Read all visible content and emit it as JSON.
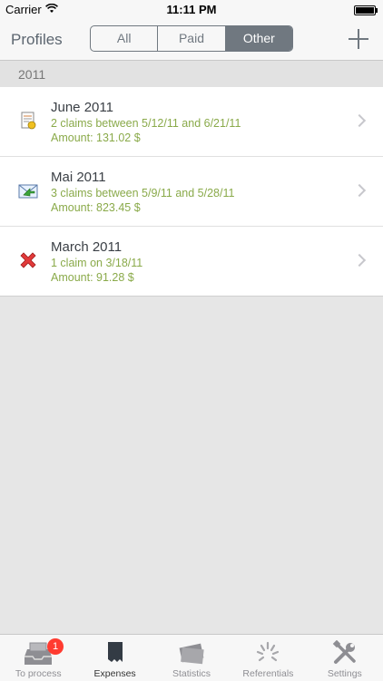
{
  "status_bar": {
    "carrier": "Carrier",
    "time": "11:11 PM"
  },
  "nav": {
    "title": "Profiles",
    "segments": [
      "All",
      "Paid",
      "Other"
    ],
    "selected_segment": "Other"
  },
  "section": {
    "header": "2011"
  },
  "rows": [
    {
      "title": "June 2011",
      "subtitle": "2 claims between 5/12/11 and 6/21/11",
      "amount": "Amount: 131.02 $",
      "icon": "document-icon"
    },
    {
      "title": "Mai 2011",
      "subtitle": "3 claims between 5/9/11 and 5/28/11",
      "amount": "Amount: 823.45 $",
      "icon": "sent-mail-icon"
    },
    {
      "title": "March 2011",
      "subtitle": "1 claim on 3/18/11",
      "amount": "Amount: 91.28 $",
      "icon": "red-x-icon"
    }
  ],
  "tabs": [
    {
      "label": "To process",
      "icon": "inbox-tray-icon",
      "badge": "1"
    },
    {
      "label": "Expenses",
      "icon": "receipt-icon",
      "active": true
    },
    {
      "label": "Statistics",
      "icon": "tickets-icon"
    },
    {
      "label": "Referentials",
      "icon": "loading-spinner-icon"
    },
    {
      "label": "Settings",
      "icon": "tools-icon"
    }
  ],
  "colors": {
    "accent_green": "#8aaa4a",
    "segment_gray": "#707880",
    "badge_red": "#ff3b30"
  }
}
